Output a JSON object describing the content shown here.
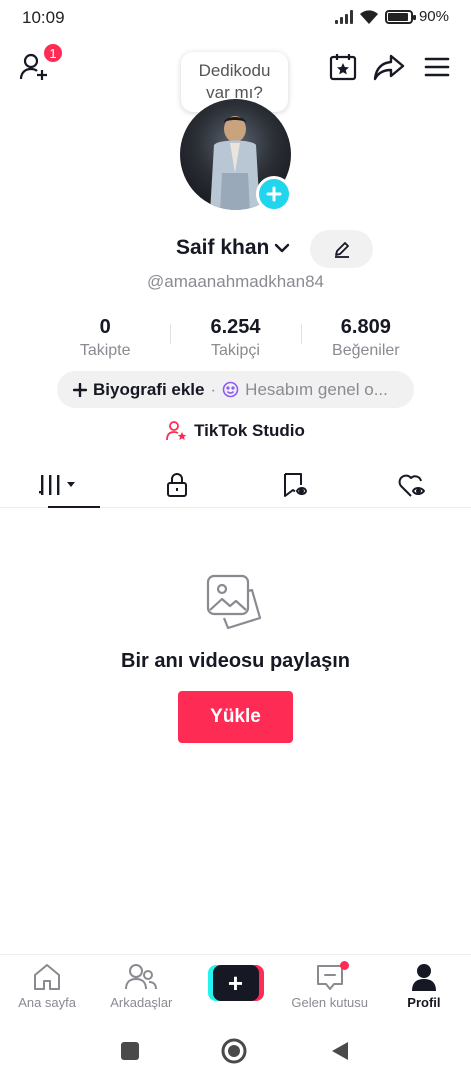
{
  "status_bar": {
    "time": "10:09",
    "battery": "90%",
    "battery_level": 0.9
  },
  "topbar": {
    "notification_count": "1"
  },
  "bubble": {
    "line1": "Dedikodu",
    "line2": "var mı?"
  },
  "profile": {
    "name": "Saif khan",
    "handle": "@amaanahmadkhan84"
  },
  "stats": [
    {
      "value": "0",
      "label": "Takipte"
    },
    {
      "value": "6.254",
      "label": "Takipçi"
    },
    {
      "value": "6.809",
      "label": "Beğeniler"
    }
  ],
  "bio": {
    "add_label": "Biyografi ekle",
    "separator": "·",
    "status_label": "Hesabım genel o..."
  },
  "studio": {
    "label": "TikTok Studio"
  },
  "empty_state": {
    "title": "Bir anı videosu paylaşın",
    "button": "Yükle"
  },
  "bottom_nav": {
    "home": "Ana sayfa",
    "friends": "Arkadaşlar",
    "create": "+",
    "inbox": "Gelen kutusu",
    "profile": "Profil"
  },
  "colors": {
    "accent": "#fe2c55",
    "cyan": "#20d5ec",
    "text": "#161823",
    "muted": "#8a8b91"
  },
  "icons": [
    "add-user-icon",
    "calendar-star-icon",
    "share-icon",
    "menu-icon",
    "edit-icon",
    "chevron-down-icon",
    "plus-icon",
    "smile-icon",
    "studio-icon",
    "grid-icon",
    "lock-icon",
    "saved-icon",
    "liked-icon",
    "image-icon",
    "home-icon",
    "friends-icon",
    "inbox-icon",
    "profile-icon"
  ]
}
